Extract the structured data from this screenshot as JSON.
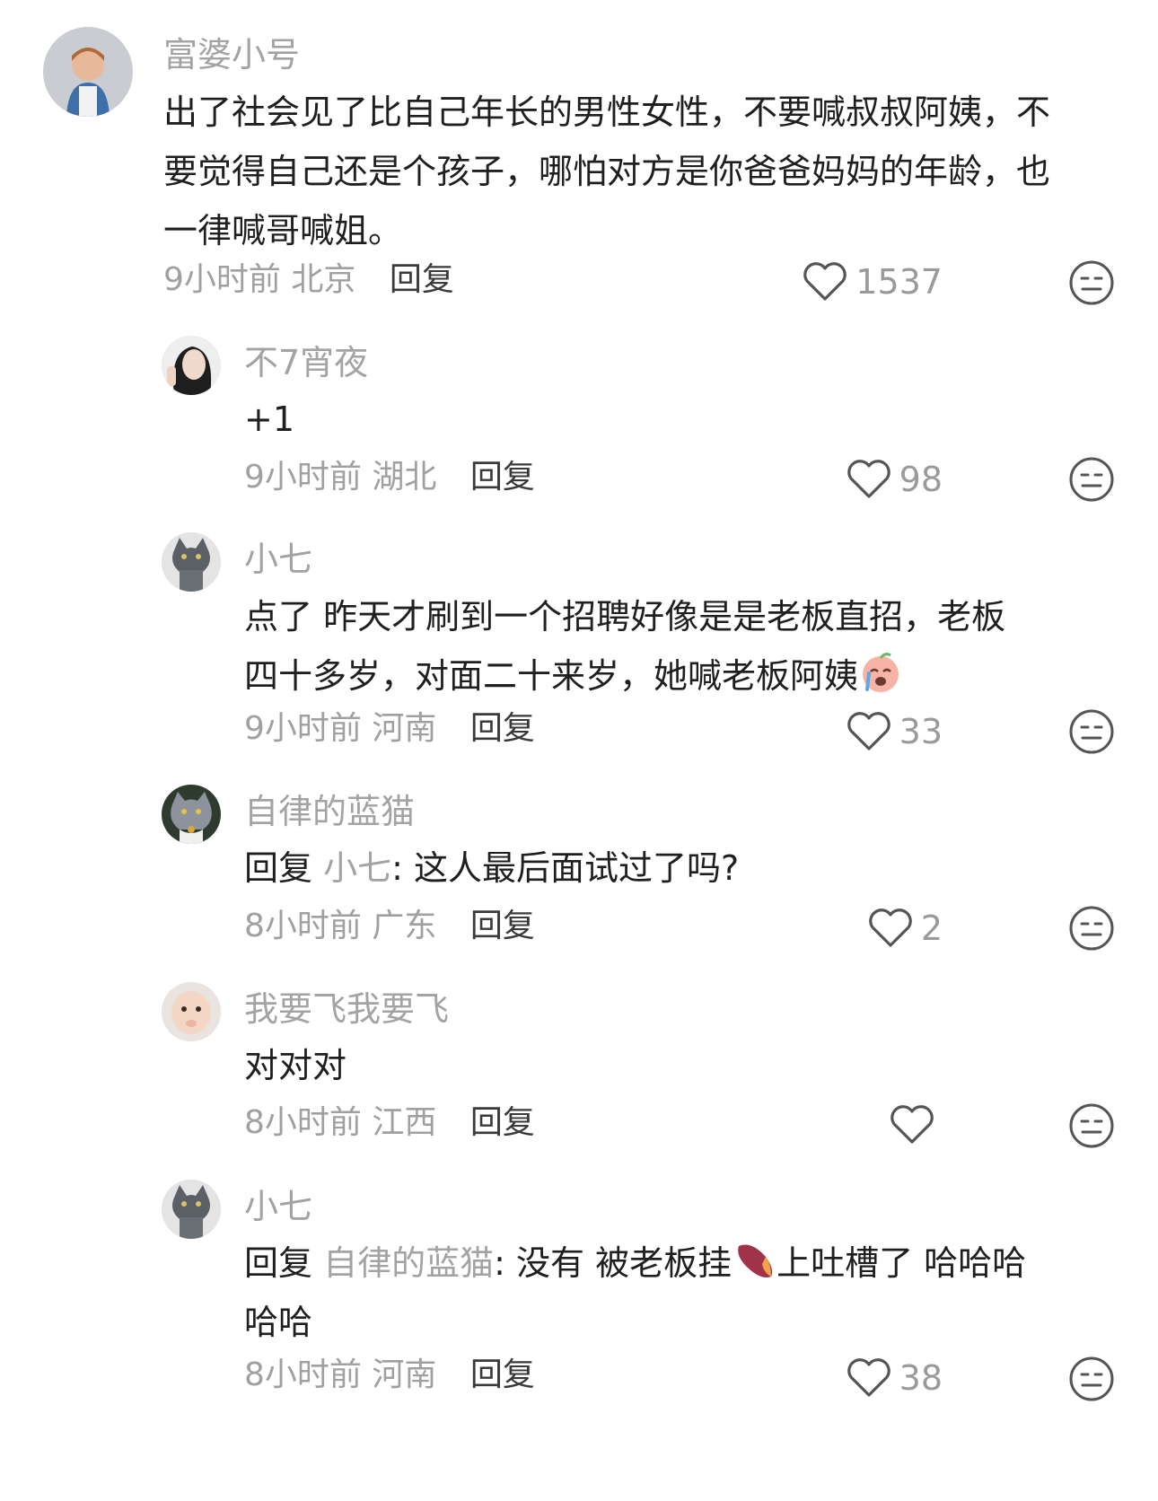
{
  "comments": [
    {
      "username": "富婆小号",
      "text": "出了社会见了比自己年长的男性女性，不要喊叔叔阿姨，不要觉得自己还是个孩子，哪怕对方是你爸爸妈妈的年龄，也一律喊哥喊姐。",
      "time": "9小时前",
      "location": "北京",
      "reply_label": "回复",
      "likes": "1537",
      "avatar": "toddler-photo-avatar"
    },
    {
      "username": "不7宵夜",
      "text": "+1",
      "time": "9小时前",
      "location": "湖北",
      "reply_label": "回复",
      "likes": "98",
      "avatar": "woman-selfie-avatar"
    },
    {
      "username": "小七",
      "text_before_emoji": "点了 昨天才刷到一个招聘好像是是老板直招，老板四十多岁，对面二十来岁，她喊老板阿姨",
      "emoji": "crying-face-emoji",
      "time": "9小时前",
      "location": "河南",
      "reply_label": "回复",
      "likes": "33",
      "avatar": "grey-cat-avatar"
    },
    {
      "username": "自律的蓝猫",
      "reply_prefix": "回复 ",
      "mention": "小七",
      "text": ": 这人最后面试过了吗?",
      "time": "8小时前",
      "location": "广东",
      "reply_label": "回复",
      "likes": "2",
      "avatar": "blue-cat-avatar"
    },
    {
      "username": "我要飞我要飞",
      "text": "对对对",
      "time": "8小时前",
      "location": "江西",
      "reply_label": "回复",
      "likes": "",
      "avatar": "baby-photo-avatar"
    },
    {
      "username": "小七",
      "reply_prefix": "回复 ",
      "mention": "自律的蓝猫",
      "text_before_emoji": ": 没有 被老板挂",
      "emoji": "sweet-potato-emoji",
      "text_after_emoji": "上吐槽了 哈哈哈哈哈",
      "time": "8小时前",
      "location": "河南",
      "reply_label": "回复",
      "likes": "38",
      "avatar": "grey-cat-avatar"
    }
  ],
  "colors": {
    "username": "#a3a3a3",
    "text": "#1f1f1f",
    "meta": "#a0a0a0",
    "icon": "#555555"
  }
}
